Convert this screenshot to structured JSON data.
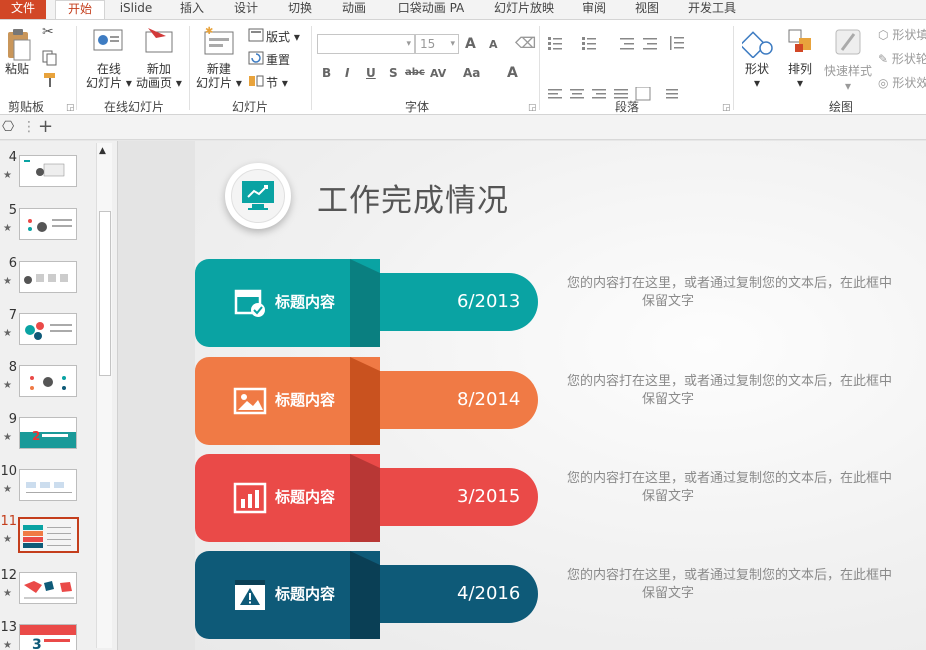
{
  "tabs": [
    {
      "label": "文件"
    },
    {
      "label": "开始"
    },
    {
      "label": "iSlide"
    },
    {
      "label": "插入"
    },
    {
      "label": "设计"
    },
    {
      "label": "切换"
    },
    {
      "label": "动画"
    },
    {
      "label": "口袋动画 PA"
    },
    {
      "label": "幻灯片放映"
    },
    {
      "label": "审阅"
    },
    {
      "label": "视图"
    },
    {
      "label": "开发工具"
    }
  ],
  "ribbon": {
    "clipboard": {
      "paste": "粘贴",
      "group": "剪贴板"
    },
    "online": {
      "online_slide_1": "在线",
      "online_slide_2": "幻灯片",
      "new_anim_1": "新加",
      "new_anim_2": "动画页",
      "group": "在线幻灯片"
    },
    "slides": {
      "new_1": "新建",
      "new_2": "幻灯片",
      "layout": "版式",
      "reset": "重置",
      "section": "节",
      "group": "幻灯片"
    },
    "font": {
      "size": "15",
      "bold": "B",
      "italic": "I",
      "underline": "U",
      "shadow": "S",
      "strike": "abc",
      "spacing": "AV",
      "case": "Aa",
      "color": "A",
      "grow": "A",
      "shrink": "A",
      "group": "字体"
    },
    "paragraph": {
      "group": "段落"
    },
    "drawing": {
      "shapes": "形状",
      "arrange": "排列",
      "quick_styles": "快速样式",
      "fill": "形状填",
      "outline": "形状轮",
      "effects": "形状效",
      "group": "绘图"
    }
  },
  "strip": {
    "add": "+"
  },
  "thumbnails": [
    {
      "num": "4"
    },
    {
      "num": "5"
    },
    {
      "num": "6"
    },
    {
      "num": "7"
    },
    {
      "num": "8"
    },
    {
      "num": "9"
    },
    {
      "num": "10"
    },
    {
      "num": "11"
    },
    {
      "num": "12"
    },
    {
      "num": "13"
    }
  ],
  "thumb_star": "★",
  "slide": {
    "title": "工作完成情况",
    "rows": [
      {
        "label": "标题内容",
        "date": "6/2013",
        "desc_1": "您的内容打在这里，或者通过复制您的文本后，在此框中",
        "desc_2": "保留文字",
        "color": "#0aa3a3",
        "dark": "#0a7f80",
        "icon": "calendar-check-icon"
      },
      {
        "label": "标题内容",
        "date": "8/2014",
        "desc_1": "您的内容打在这里，或者通过复制您的文本后，在此框中",
        "desc_2": "保留文字",
        "color": "#f07a45",
        "dark": "#c9521f",
        "icon": "image-icon"
      },
      {
        "label": "标题内容",
        "date": "3/2015",
        "desc_1": "您的内容打在这里，或者通过复制您的文本后，在此框中",
        "desc_2": "保留文字",
        "color": "#ea4a48",
        "dark": "#b83735",
        "icon": "bar-chart-icon"
      },
      {
        "label": "标题内容",
        "date": "4/2016",
        "desc_1": "您的内容打在这里，或者通过复制您的文本后，在此框中",
        "desc_2": "保留文字",
        "color": "#0e5a78",
        "dark": "#0a3f55",
        "icon": "warning-icon"
      }
    ]
  },
  "colors": {
    "accent": "#c43e1c",
    "teal": "#0aa3a3"
  }
}
